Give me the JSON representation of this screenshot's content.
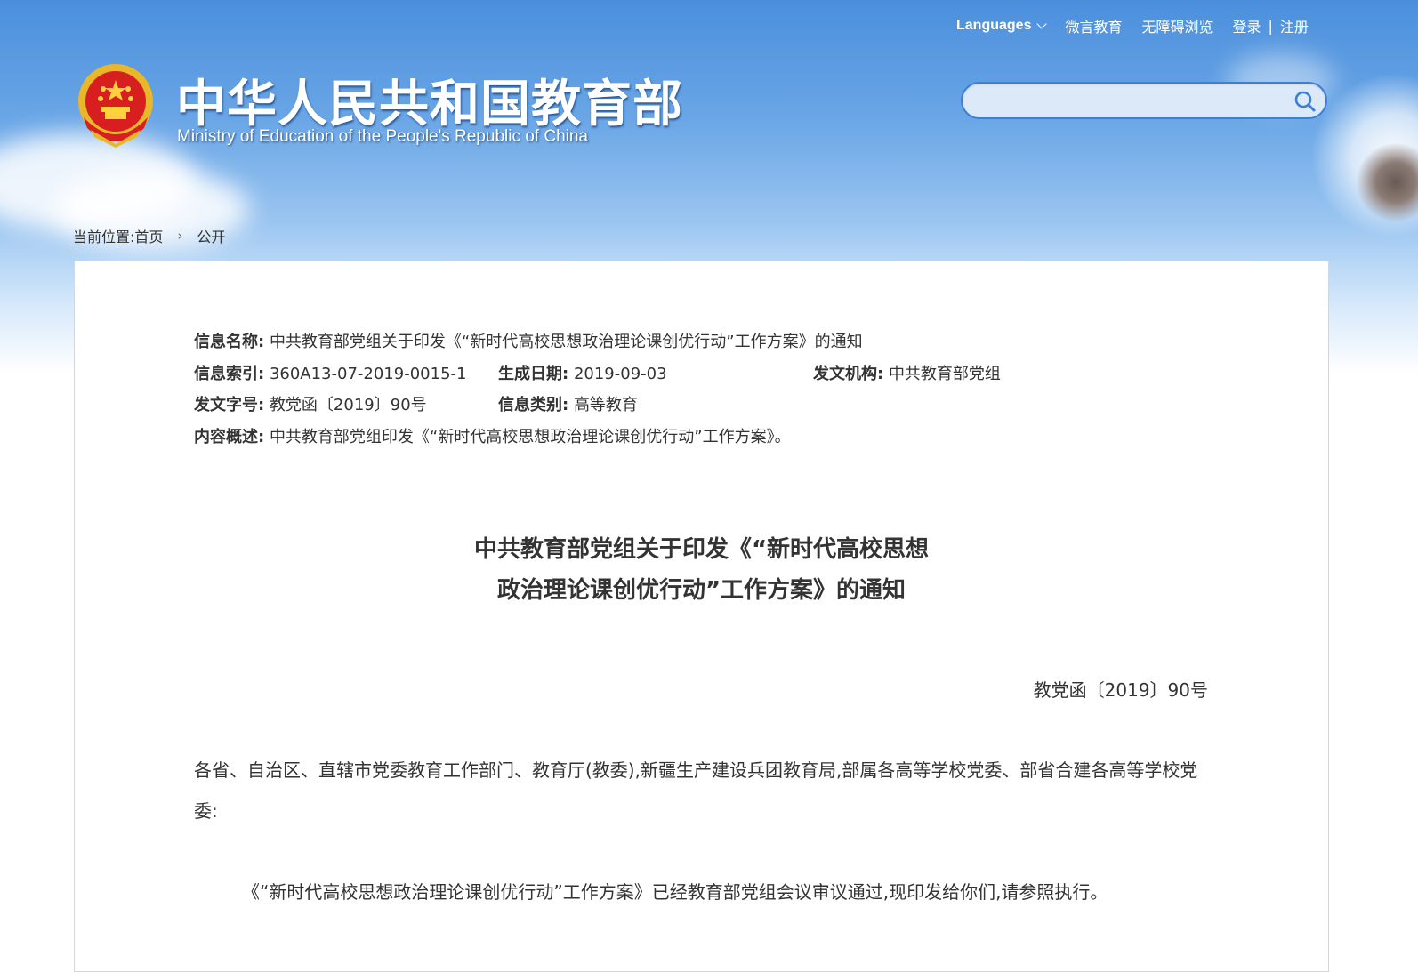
{
  "header": {
    "title_cn": "中华人民共和国教育部",
    "title_en": "Ministry of Education of the People's Republic of China",
    "emblem_icon": "national-emblem-icon"
  },
  "topnav": {
    "languages": "Languages",
    "weiyan": "微言教育",
    "accessible": "无障碍浏览",
    "login": "登录",
    "separator": "|",
    "register": "注册"
  },
  "search": {
    "placeholder": "",
    "value": "",
    "icon": "search-icon",
    "accent": "#3f7fd3"
  },
  "breadcrumb": {
    "prefix": "当前位置:",
    "home": "首页",
    "arrow": "›",
    "current": "公开"
  },
  "meta": {
    "name_label": "信息名称:",
    "name_value": "中共教育部党组关于印发《“新时代高校思想政治理论课创优行动”工作方案》的通知",
    "index_label": "信息索引:",
    "index_value": "360A13-07-2019-0015-1",
    "date_label": "生成日期:",
    "date_value": "2019-09-03",
    "org_label": "发文机构:",
    "org_value": "中共教育部党组",
    "docno_label": "发文字号:",
    "docno_value": "教党函〔2019〕90号",
    "category_label": "信息类别:",
    "category_value": "高等教育",
    "summary_label": "内容概述:",
    "summary_value": "中共教育部党组印发《“新时代高校思想政治理论课创优行动”工作方案》。"
  },
  "document": {
    "title_line1": "中共教育部党组关于印发《“新时代高校思想",
    "title_line2": "政治理论课创优行动”工作方案》的通知",
    "number": "教党函〔2019〕90号",
    "addressee": "各省、自治区、直辖市党委教育工作部门、教育厅(教委),新疆生产建设兵团教育局,部属各高等学校党委、部省合建各高等学校党委:",
    "paragraph1": "《“新时代高校思想政治理论课创优行动”工作方案》已经教育部党组会议审议通过,现印发给你们,请参照执行。"
  }
}
